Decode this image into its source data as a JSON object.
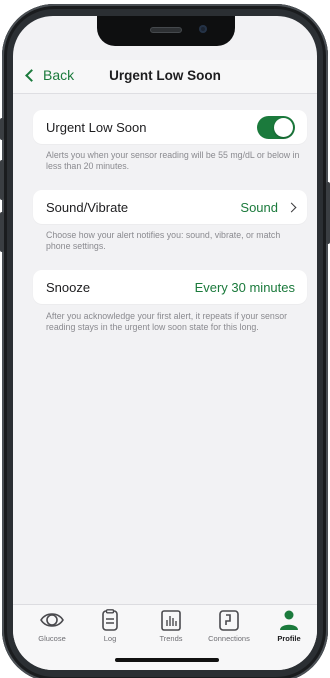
{
  "nav": {
    "back_label": "Back",
    "title": "Urgent Low Soon"
  },
  "settings": {
    "alert_toggle": {
      "label": "Urgent Low Soon",
      "enabled": true,
      "description": "Alerts you when your sensor reading will be 55 mg/dL or below in less than 20 minutes."
    },
    "sound": {
      "label": "Sound/Vibrate",
      "value": "Sound",
      "description": "Choose how your alert notifies you: sound, vibrate, or match phone settings."
    },
    "snooze": {
      "label": "Snooze",
      "value": "Every 30 minutes",
      "description": "After you acknowledge your first alert, it repeats if your sensor reading stays in the urgent low soon state for this long."
    }
  },
  "tabs": [
    {
      "label": "Glucose",
      "icon": "glucose-eye-icon"
    },
    {
      "label": "Log",
      "icon": "log-clipboard-icon"
    },
    {
      "label": "Trends",
      "icon": "trends-bar-chart-icon"
    },
    {
      "label": "Connections",
      "icon": "connections-icon"
    },
    {
      "label": "Profile",
      "icon": "profile-person-icon",
      "active": true
    }
  ],
  "colors": {
    "accent": "#1b7a3c",
    "background": "#f2f2f4",
    "helper_text": "#8a8a8f"
  }
}
